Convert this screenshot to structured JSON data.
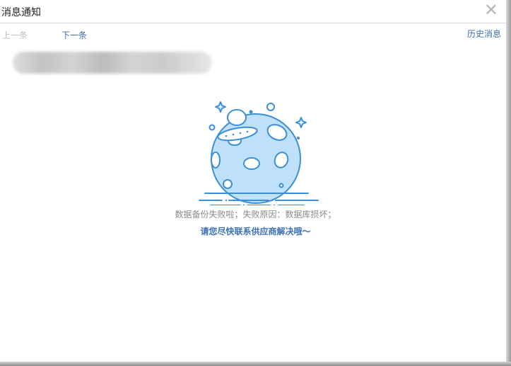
{
  "dialog": {
    "title": "消息通知",
    "close_symbol": "✕",
    "prev_label": "上一条",
    "next_label": "下一条",
    "history_label": "历史消息"
  },
  "empty_state": {
    "illustration_icon": "planet-ufo-icon",
    "message": "数据备份失败啦；失败原因：数据库损坏；",
    "action_hint": "请您尽快联系供应商解决哦～"
  },
  "colors": {
    "accent": "#3d72b8",
    "illustration_stroke": "#3a8fd8",
    "illustration_fill": "#bfe0fb",
    "muted_text": "#8a8a8a",
    "disabled_text": "#c0c0c0"
  }
}
